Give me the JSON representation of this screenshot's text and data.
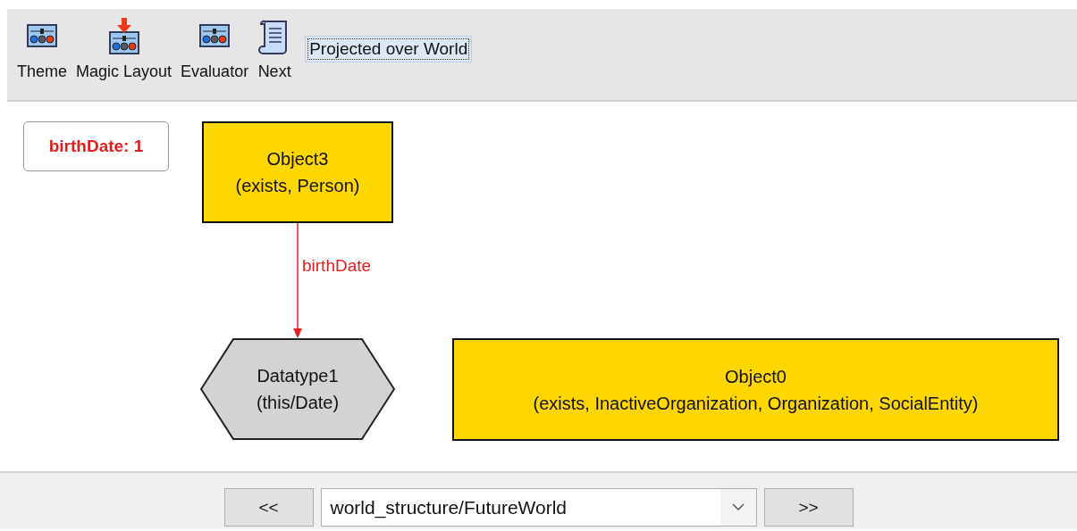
{
  "toolbar": {
    "buttons": [
      {
        "label": "Theme",
        "kind": "slider"
      },
      {
        "label": "Magic Layout",
        "kind": "slider-arrow"
      },
      {
        "label": "Evaluator",
        "kind": "slider"
      },
      {
        "label": "Next",
        "kind": "scroll"
      }
    ],
    "projection_toggle": {
      "label": "Projected over World"
    }
  },
  "canvas": {
    "badge": "birthDate: 1",
    "nodes": [
      {
        "kind": "box",
        "lines": [
          "Object3",
          "(exists, Person)"
        ]
      },
      {
        "kind": "hexagon",
        "lines": [
          "Datatype1",
          "(this/Date)"
        ]
      },
      {
        "kind": "box",
        "lines": [
          "Object0",
          "(exists, InactiveOrganization, Organization, SocialEntity)"
        ]
      }
    ],
    "edges": [
      {
        "label": "birthDate"
      }
    ]
  },
  "navigation": {
    "previous": "<<",
    "instance": "world_structure/FutureWorld",
    "next": ">>"
  }
}
